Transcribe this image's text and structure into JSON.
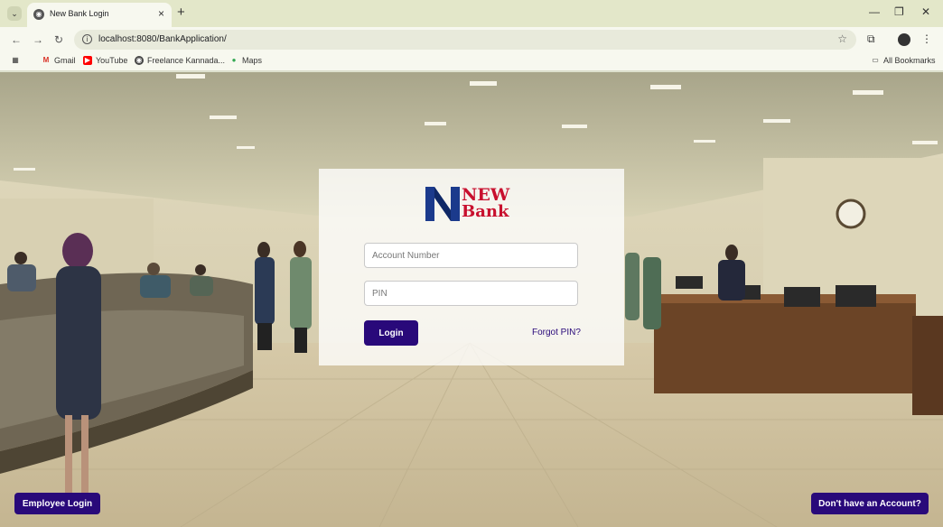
{
  "browser": {
    "tab_title": "New Bank Login",
    "url": "localhost:8080/BankApplication/",
    "bookmarks": [
      {
        "label": "Gmail",
        "icon": "gmail-icon"
      },
      {
        "label": "YouTube",
        "icon": "youtube-icon"
      },
      {
        "label": "Freelance Kannada...",
        "icon": "globe-icon"
      },
      {
        "label": "Maps",
        "icon": "maps-icon"
      }
    ],
    "all_bookmarks": "All Bookmarks"
  },
  "logo": {
    "line1": "NEW",
    "line2": "Bank"
  },
  "login": {
    "account_placeholder": "Account Number",
    "pin_placeholder": "PIN",
    "login_label": "Login",
    "forgot_label": "Forgot PIN?"
  },
  "footer": {
    "employee_label": "Employee Login",
    "signup_label": "Don't have an Account?"
  },
  "colors": {
    "accent": "#29097a",
    "brand_red": "#c8102e",
    "brand_blue": "#1b3a8c"
  }
}
